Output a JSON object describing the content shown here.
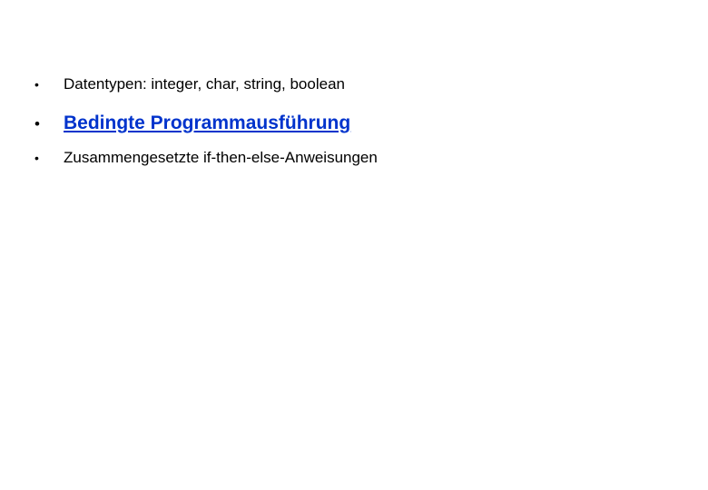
{
  "bullets": [
    {
      "marker": "•",
      "text": "Datentypen: integer, char, string, boolean",
      "style": "normal"
    },
    {
      "marker": "•",
      "text": "Bedingte Programmausführung",
      "style": "emph"
    },
    {
      "marker": "•",
      "text": "Zusammengesetzte if-then-else-Anweisungen",
      "style": "normal"
    }
  ]
}
